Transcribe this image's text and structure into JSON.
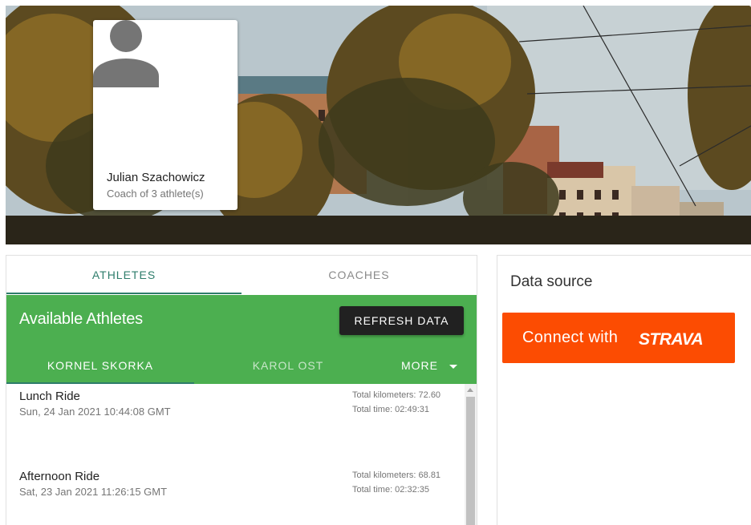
{
  "profile": {
    "name": "Julian Szachowicz",
    "role": "Coach of 3 athlete(s)"
  },
  "tabs": {
    "athletes": "ATHLETES",
    "coaches": "COACHES"
  },
  "athletes_panel": {
    "title": "Available Athletes",
    "refresh_label": "REFRESH DATA",
    "athlete_tabs": [
      "KORNEL SKORKA",
      "KAROL OST"
    ],
    "more_label": "MORE"
  },
  "activities": [
    {
      "name": "Lunch Ride",
      "date": "Sun, 24 Jan 2021 10:44:08 GMT",
      "km": "Total kilometers: 72.60",
      "time": "Total time: 02:49:31"
    },
    {
      "name": "Afternoon Ride",
      "date": "Sat, 23 Jan 2021 11:26:15 GMT",
      "km": "Total kilometers: 68.81",
      "time": "Total time: 02:32:35"
    }
  ],
  "data_source": {
    "title": "Data source",
    "connect_label": "Connect with",
    "brand": "STRAVA"
  },
  "colors": {
    "accent_green": "#4caf50",
    "tab_teal": "#2e7d6b",
    "strava_orange": "#fc4c02",
    "button_dark": "#212121"
  },
  "icons": {
    "avatar": "person-icon",
    "more_dropdown": "caret-down-icon"
  }
}
